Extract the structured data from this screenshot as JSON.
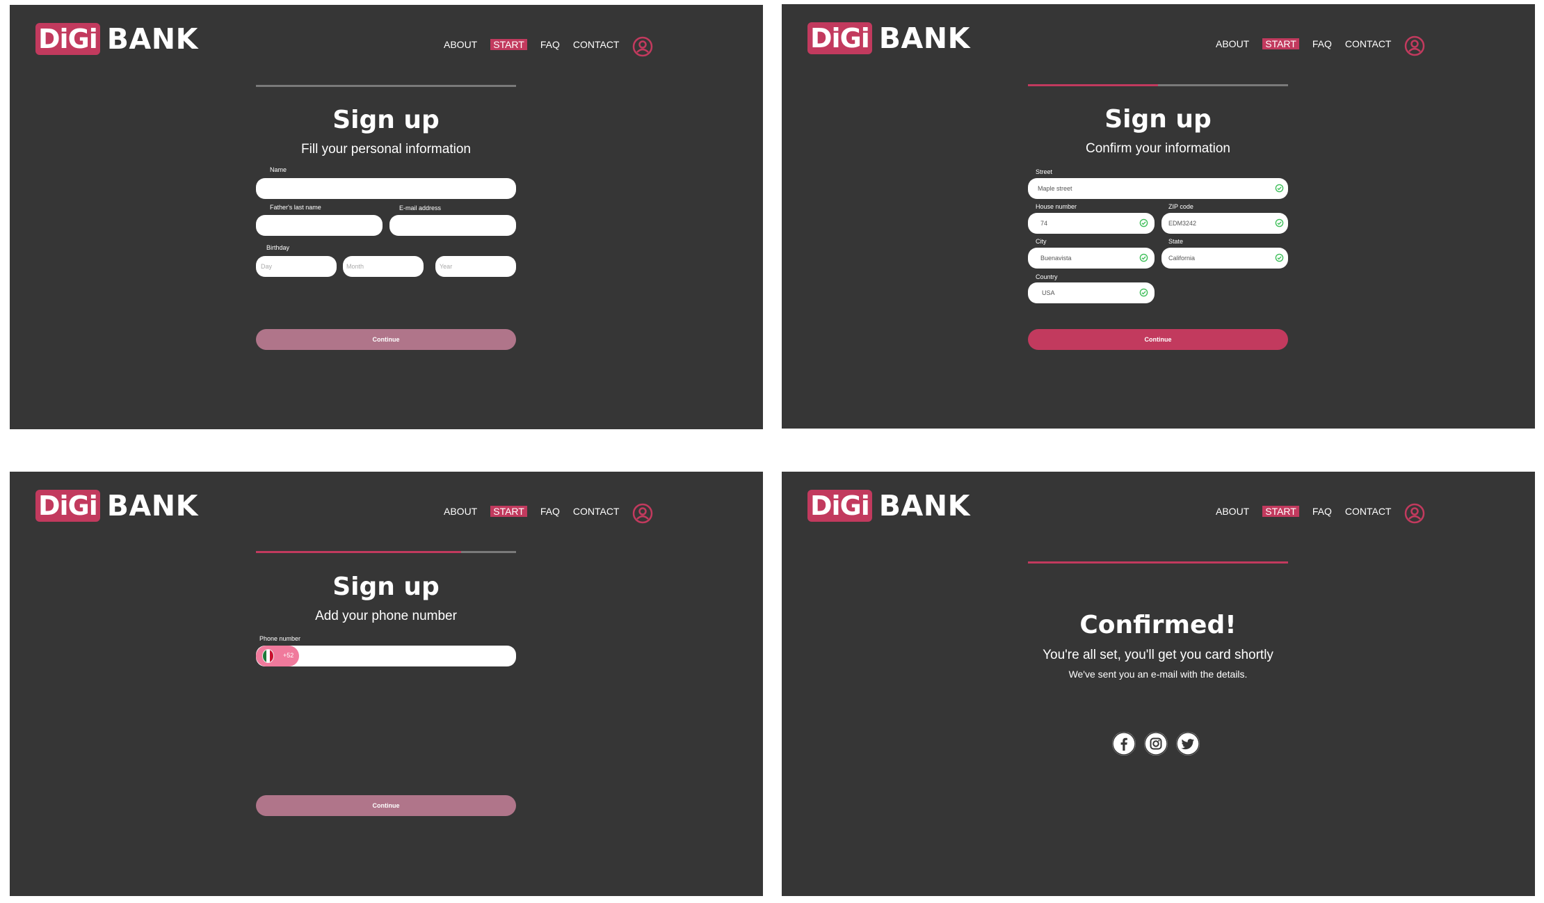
{
  "brand": {
    "logo_badge": "DiGi",
    "logo_text": "BANK"
  },
  "nav": {
    "about": "ABOUT",
    "start": "START",
    "faq": "FAQ",
    "contact": "CONTACT"
  },
  "colors": {
    "accent": "#c23a5e",
    "panel_bg": "#363636",
    "disabled_button": "#b0758a",
    "check_green": "#3fbf5a"
  },
  "screen1": {
    "progress": 0,
    "title": "Sign up",
    "subtitle": "Fill your personal information",
    "name_label": "Name",
    "fathers_label": "Father's last name",
    "email_label": "E-mail address",
    "birthday_label": "Birthday",
    "day_placeholder": "Day",
    "month_placeholder": "Month",
    "year_placeholder": "Year",
    "continue": "Continue"
  },
  "screen2": {
    "progress": 0.5,
    "title": "Sign up",
    "subtitle": "Confirm your information",
    "street_label": "Street",
    "street_value": "Maple street",
    "house_label": "House number",
    "house_value": "74",
    "zip_label": "ZIP code",
    "zip_value": "EDM3242",
    "city_label": "City",
    "city_value": "Buenavista",
    "state_label": "State",
    "state_value": "California",
    "country_label": "Country",
    "country_value": "USA",
    "continue": "Continue"
  },
  "screen3": {
    "progress": 0.79,
    "title": "Sign up",
    "subtitle": "Add your phone number",
    "phone_label": "Phone number",
    "dial_code": "+52",
    "continue": "Continue"
  },
  "screen4": {
    "progress": 1,
    "title": "Confirmed!",
    "subtitle": "You're all set, you'll get you card shortly",
    "subtitle2": "We've sent you an e-mail with the details.",
    "social_icons": [
      "facebook-icon",
      "instagram-icon",
      "twitter-icon"
    ]
  }
}
